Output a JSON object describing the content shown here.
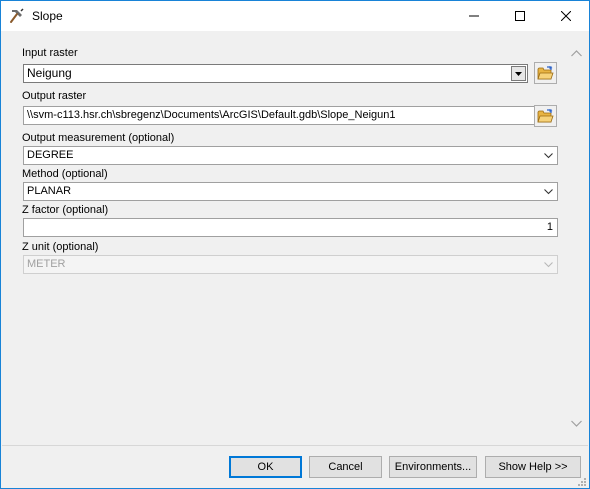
{
  "window": {
    "title": "Slope",
    "icon": "slope-tool-icon"
  },
  "params": {
    "input_raster": {
      "label": "Input raster",
      "value": "Neigung",
      "browse_icon": "open-folder-icon"
    },
    "output_raster": {
      "label": "Output raster",
      "value": "\\\\svm-c113.hsr.ch\\sbregenz\\Documents\\ArcGIS\\Default.gdb\\Slope_Neigun1",
      "browse_icon": "open-folder-icon"
    },
    "output_measurement": {
      "label": "Output measurement (optional)",
      "value": "DEGREE"
    },
    "method": {
      "label": "Method (optional)",
      "value": "PLANAR"
    },
    "z_factor": {
      "label": "Z factor (optional)",
      "value": "1"
    },
    "z_unit": {
      "label": "Z unit (optional)",
      "value": "METER",
      "enabled": false
    }
  },
  "buttons": {
    "ok": "OK",
    "cancel": "Cancel",
    "environments": "Environments...",
    "show_help": "Show Help >>"
  },
  "colors": {
    "accent": "#0078d7",
    "window_border": "#1883d7",
    "background": "#f0f0f0",
    "folder_yellow": "#e8b443"
  }
}
